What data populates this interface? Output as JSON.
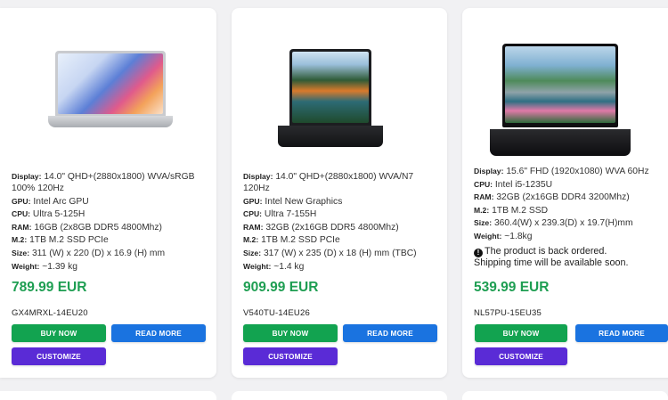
{
  "products": [
    {
      "image_alt": "silver laptop with colorful wave wallpaper",
      "specs": [
        {
          "key": "Display:",
          "value": "14.0\" QHD+(2880x1800) WVA/sRGB 100% 120Hz"
        },
        {
          "key": "GPU:",
          "value": "Intel Arc GPU"
        },
        {
          "key": "CPU:",
          "value": "Ultra 5-125H"
        },
        {
          "key": "RAM:",
          "value": "16GB (2x8GB DDR5 4800Mhz)"
        },
        {
          "key": "M.2:",
          "value": "1TB M.2 SSD PCIe"
        },
        {
          "key": "Size:",
          "value": "311 (W) x 220 (D) x 16.9 (H) mm"
        },
        {
          "key": "Weight:",
          "value": "~1.39 kg"
        }
      ],
      "notice": "",
      "price": "789.99 EUR",
      "sku": "GX4MRXL-14EU20"
    },
    {
      "image_alt": "dark laptop with river landscape wallpaper",
      "specs": [
        {
          "key": "Display:",
          "value": "14.0\" QHD+(2880x1800) WVA/N7 120Hz"
        },
        {
          "key": "GPU:",
          "value": "Intel New Graphics"
        },
        {
          "key": "CPU:",
          "value": "Ultra 7-155H"
        },
        {
          "key": "RAM:",
          "value": "32GB (2x16GB DDR5 4800Mhz)"
        },
        {
          "key": "M.2:",
          "value": "1TB M.2 SSD PCIe"
        },
        {
          "key": "Size:",
          "value": "317 (W) x 235 (D) x 18 (H) mm (TBC)"
        },
        {
          "key": "Weight:",
          "value": "~1.4 kg"
        }
      ],
      "notice": "",
      "price": "909.99 EUR",
      "sku": "V540TU-14EU26"
    },
    {
      "image_alt": "black laptop with lake and lotus wallpaper",
      "specs": [
        {
          "key": "Display:",
          "value": "15.6\" FHD (1920x1080) WVA 60Hz"
        },
        {
          "key": "CPU:",
          "value": "Intel i5-1235U"
        },
        {
          "key": "RAM:",
          "value": "32GB (2x16GB DDR4 3200Mhz)"
        },
        {
          "key": "M.2:",
          "value": "1TB M.2 SSD"
        },
        {
          "key": "Size:",
          "value": "360.4(W) x 239.3(D) x 19.7(H)mm"
        },
        {
          "key": "Weight:",
          "value": "~1.8kg"
        }
      ],
      "notice_line1": "The product is back ordered.",
      "notice_line2": "Shipping time will be available soon.",
      "price": "539.99 EUR",
      "sku": "NL57PU-15EU35"
    }
  ],
  "buttons": {
    "buy": "BUY NOW",
    "read": "READ MORE",
    "customize": "CUSTOMIZE"
  },
  "colors": {
    "price": "#1e9e52",
    "buy": "#12a350",
    "read": "#1a73e0",
    "customize": "#5a2bd6"
  }
}
